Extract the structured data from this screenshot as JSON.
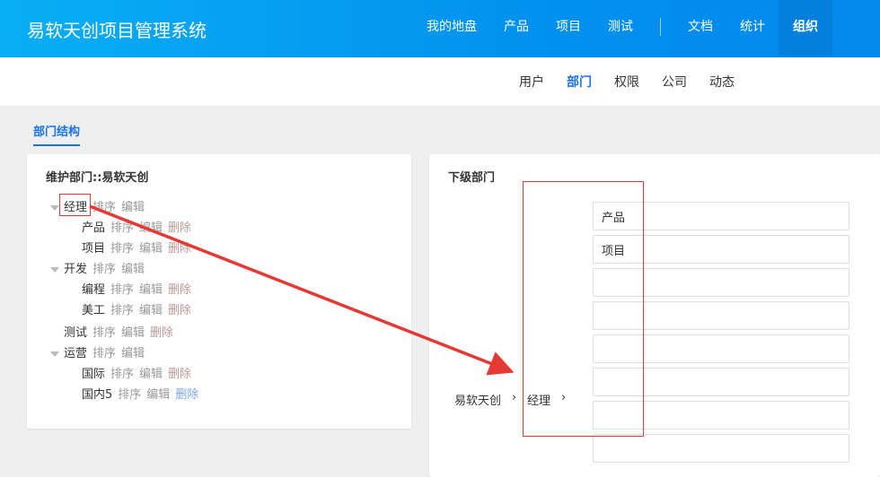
{
  "header": {
    "brand": "易软天创项目管理系统",
    "nav": [
      "我的地盘",
      "产品",
      "项目",
      "测试"
    ],
    "nav2": [
      "文档",
      "统计"
    ],
    "active": "组织"
  },
  "subnav": {
    "items": [
      "用户",
      "部门",
      "权限",
      "公司",
      "动态"
    ]
  },
  "tab": "部门结构",
  "left": {
    "title": "维护部门::易软天创",
    "actions": {
      "sort": "排序",
      "edit": "编辑",
      "delete": "删除"
    },
    "tree": [
      {
        "name": "经理",
        "level": 0,
        "expanded": true,
        "deletable": false
      },
      {
        "name": "产品",
        "level": 1,
        "deletable": true
      },
      {
        "name": "项目",
        "level": 1,
        "deletable": true
      },
      {
        "name": "开发",
        "level": 0,
        "expanded": true,
        "deletable": false
      },
      {
        "name": "编程",
        "level": 1,
        "deletable": true
      },
      {
        "name": "美工",
        "level": 1,
        "deletable": true
      },
      {
        "name": "测试",
        "level": 0,
        "leaf": true,
        "deletable": true
      },
      {
        "name": "运营",
        "level": 0,
        "expanded": true,
        "deletable": false
      },
      {
        "name": "国际",
        "level": 1,
        "deletable": true
      },
      {
        "name": "国内5",
        "level": 1,
        "deletable": true
      }
    ]
  },
  "right": {
    "title": "下级部门",
    "breadcrumb": [
      "易软天创",
      "经理"
    ],
    "separator": "›",
    "inputs": [
      "产品",
      "项目",
      "",
      "",
      "",
      "",
      "",
      ""
    ]
  },
  "colors": {
    "accent": "#1a73e8",
    "annotation": "#e53935"
  }
}
